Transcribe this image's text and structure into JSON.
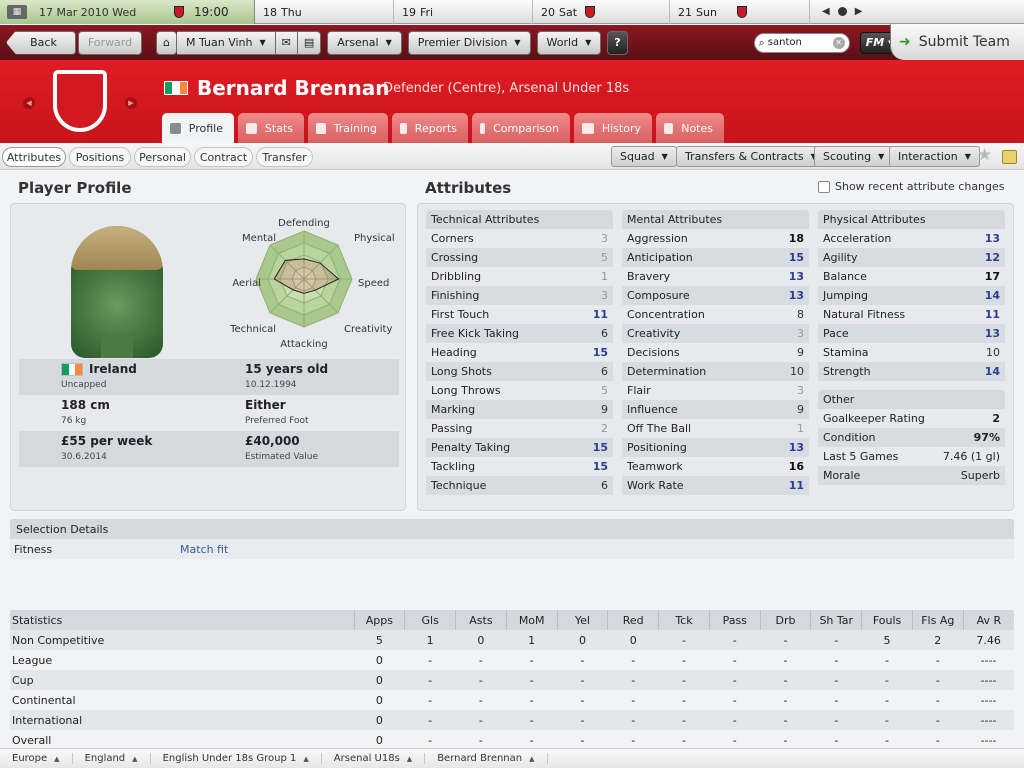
{
  "calendar": {
    "date": "17 Mar 2010 Wed",
    "time": "19:00",
    "days": [
      {
        "num": "18",
        "day": "Thu",
        "match": false
      },
      {
        "num": "19",
        "day": "Fri",
        "match": false
      },
      {
        "num": "20",
        "day": "Sat",
        "match": true
      },
      {
        "num": "21",
        "day": "Sun",
        "match": true
      }
    ]
  },
  "toolbar": {
    "back": "Back",
    "forward": "Forward",
    "manager": "M Tuan Vinh",
    "club": "Arsenal",
    "competition": "Premier Division",
    "world": "World",
    "search_value": "santon",
    "fm": "FM",
    "submit": "Submit Team"
  },
  "colors": {
    "accent": "#d81a22",
    "link": "#3c5a8f",
    "highlight_value": "#2a3f8f"
  },
  "player": {
    "name": "Bernard Brennan",
    "role": "Defender (Centre), Arsenal Under 18s"
  },
  "tabs": [
    {
      "label": "Profile",
      "icon": "profile-icon",
      "active": true
    },
    {
      "label": "Stats",
      "icon": "stats-icon"
    },
    {
      "label": "Training",
      "icon": "training-icon"
    },
    {
      "label": "Reports",
      "icon": "reports-icon"
    },
    {
      "label": "Comparison",
      "icon": "comparison-icon"
    },
    {
      "label": "History",
      "icon": "history-icon"
    },
    {
      "label": "Notes",
      "icon": "notes-icon"
    }
  ],
  "subtabs": [
    "Attributes",
    "Positions",
    "Personal",
    "Contract",
    "Transfer"
  ],
  "menus": [
    "Squad",
    "Transfers & Contracts",
    "Scouting",
    "Interaction"
  ],
  "profile": {
    "heading": "Player Profile",
    "radar_labels": [
      "Defending",
      "Physical",
      "Speed",
      "Creativity",
      "Attacking",
      "Technical",
      "Aerial",
      "Mental"
    ],
    "radar_values": [
      0.42,
      0.47,
      0.72,
      0.33,
      0.3,
      0.32,
      0.62,
      0.55
    ],
    "info": [
      {
        "left_value": "Ireland",
        "left_sub": "Uncapped",
        "right_value": "15 years old",
        "right_sub": "10.12.1994"
      },
      {
        "left_value": "188 cm",
        "left_sub": "76 kg",
        "right_value": "Either",
        "right_sub": "Preferred Foot"
      },
      {
        "left_value": "£55 per week",
        "left_sub": "30.6.2014",
        "right_value": "£40,000",
        "right_sub": "Estimated Value"
      }
    ]
  },
  "attributes": {
    "heading": "Attributes",
    "show_recent": "Show recent attribute changes",
    "technical": {
      "title": "Technical Attributes",
      "items": [
        [
          "Corners",
          "3"
        ],
        [
          "Crossing",
          "5"
        ],
        [
          "Dribbling",
          "1"
        ],
        [
          "Finishing",
          "3"
        ],
        [
          "First Touch",
          "11"
        ],
        [
          "Free Kick Taking",
          "6"
        ],
        [
          "Heading",
          "15"
        ],
        [
          "Long Shots",
          "6"
        ],
        [
          "Long Throws",
          "5"
        ],
        [
          "Marking",
          "9"
        ],
        [
          "Passing",
          "2"
        ],
        [
          "Penalty Taking",
          "15"
        ],
        [
          "Tackling",
          "15"
        ],
        [
          "Technique",
          "6"
        ]
      ]
    },
    "mental": {
      "title": "Mental Attributes",
      "items": [
        [
          "Aggression",
          "18"
        ],
        [
          "Anticipation",
          "15"
        ],
        [
          "Bravery",
          "13"
        ],
        [
          "Composure",
          "13"
        ],
        [
          "Concentration",
          "8"
        ],
        [
          "Creativity",
          "3"
        ],
        [
          "Decisions",
          "9"
        ],
        [
          "Determination",
          "10"
        ],
        [
          "Flair",
          "3"
        ],
        [
          "Influence",
          "9"
        ],
        [
          "Off The Ball",
          "1"
        ],
        [
          "Positioning",
          "13"
        ],
        [
          "Teamwork",
          "16"
        ],
        [
          "Work Rate",
          "11"
        ]
      ]
    },
    "physical": {
      "title": "Physical Attributes",
      "items": [
        [
          "Acceleration",
          "13"
        ],
        [
          "Agility",
          "12"
        ],
        [
          "Balance",
          "17"
        ],
        [
          "Jumping",
          "14"
        ],
        [
          "Natural Fitness",
          "11"
        ],
        [
          "Pace",
          "13"
        ],
        [
          "Stamina",
          "10"
        ],
        [
          "Strength",
          "14"
        ]
      ]
    },
    "other": {
      "title": "Other",
      "items": [
        [
          "Goalkeeper Rating",
          "2"
        ],
        [
          "Condition",
          "97%"
        ],
        [
          "Last 5 Games",
          "7.46 (1 gl)"
        ],
        [
          "Morale",
          "Superb"
        ]
      ]
    }
  },
  "selection": {
    "title": "Selection Details",
    "label": "Fitness",
    "value": "Match fit"
  },
  "statistics": {
    "columns": [
      "Statistics",
      "Apps",
      "Gls",
      "Asts",
      "MoM",
      "Yel",
      "Red",
      "Tck",
      "Pass",
      "Drb",
      "Sh Tar",
      "Fouls",
      "Fls Ag",
      "Av R"
    ],
    "rows": [
      [
        "Non Competitive",
        "5",
        "1",
        "0",
        "1",
        "0",
        "0",
        "-",
        "-",
        "-",
        "-",
        "5",
        "2",
        "7.46"
      ],
      [
        "League",
        "0",
        "-",
        "-",
        "-",
        "-",
        "-",
        "-",
        "-",
        "-",
        "-",
        "-",
        "-",
        "----"
      ],
      [
        "Cup",
        "0",
        "-",
        "-",
        "-",
        "-",
        "-",
        "-",
        "-",
        "-",
        "-",
        "-",
        "-",
        "----"
      ],
      [
        "Continental",
        "0",
        "-",
        "-",
        "-",
        "-",
        "-",
        "-",
        "-",
        "-",
        "-",
        "-",
        "-",
        "----"
      ],
      [
        "International",
        "0",
        "-",
        "-",
        "-",
        "-",
        "-",
        "-",
        "-",
        "-",
        "-",
        "-",
        "-",
        "----"
      ],
      [
        "Overall",
        "0",
        "-",
        "-",
        "-",
        "-",
        "-",
        "-",
        "-",
        "-",
        "-",
        "-",
        "-",
        "----"
      ]
    ]
  },
  "breadcrumbs": [
    "Europe",
    "England",
    "English Under 18s Group 1",
    "Arsenal U18s",
    "Bernard Brennan"
  ]
}
